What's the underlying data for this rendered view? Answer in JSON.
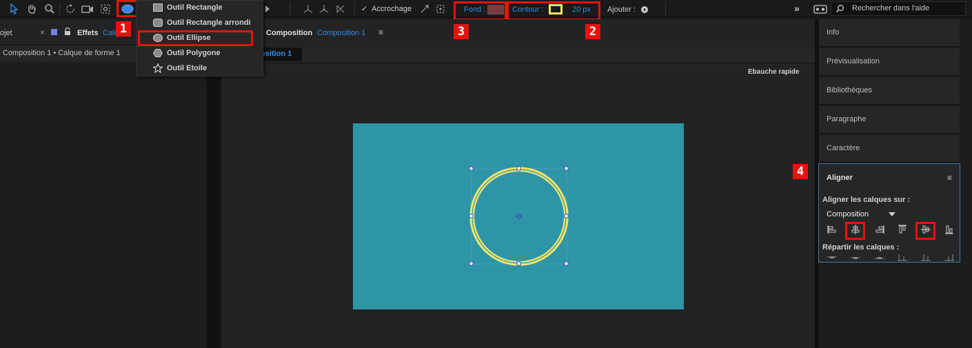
{
  "toolbar": {
    "snap_label": "Accrochage",
    "fill_label": "Fond :",
    "stroke_label": "Contour :",
    "stroke_width": "20 px",
    "add_label": "Ajouter :",
    "search_placeholder": "Rechercher dans l'aide",
    "fill_color": "#7a3a44",
    "stroke_color": "#f1e46b"
  },
  "shape_menu": {
    "items": [
      {
        "label": "Outil Rectangle",
        "icon": "rectangle-icon"
      },
      {
        "label": "Outil Rectangle arrondi",
        "icon": "rounded-rectangle-icon"
      },
      {
        "label": "Outil Ellipse",
        "icon": "ellipse-icon"
      },
      {
        "label": "Outil Polygone",
        "icon": "polygon-icon"
      },
      {
        "label": "Outil Etoile",
        "icon": "star-icon"
      }
    ]
  },
  "left_panel": {
    "project_tab": "ojet",
    "effects_tab": "Effets",
    "effects_target": "Calq",
    "breadcrumb": "Composition 1 • Calque de forme 1"
  },
  "composition": {
    "header_label": "Composition",
    "header_name": "Composition 1",
    "tab_label": "osition 1",
    "draft_label": "Ebauche rapide",
    "stage_color": "#2e95a6"
  },
  "right_panels": {
    "items": [
      "Info",
      "Prévisualisation",
      "Bibliothèques",
      "Paragraphe",
      "Caractère"
    ]
  },
  "align_panel": {
    "title": "Aligner",
    "align_to_label": "Aligner les calques sur :",
    "align_to_value": "Composition",
    "distribute_label": "Répartir les calques :"
  },
  "callouts": [
    "1",
    "2",
    "3",
    "4"
  ],
  "accent_colors": {
    "highlight_red": "#e8130e",
    "ui_blue": "#2d8ceb"
  }
}
